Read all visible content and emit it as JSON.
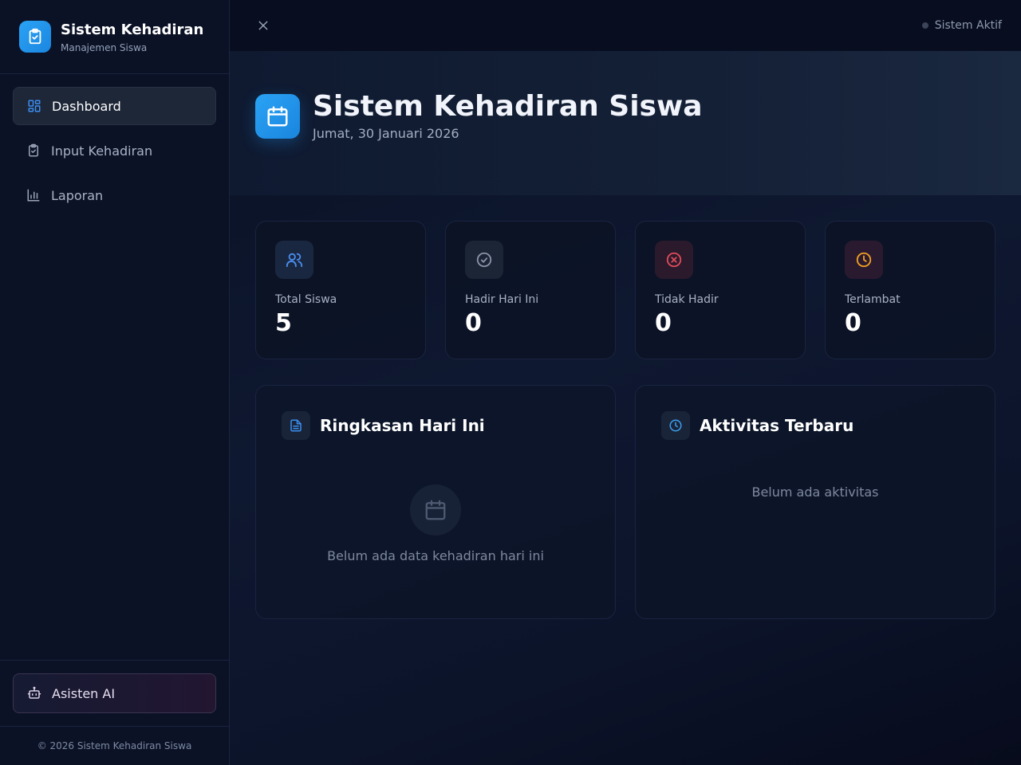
{
  "brand": {
    "title": "Sistem Kehadiran",
    "subtitle": "Manajemen Siswa",
    "logo_icon": "clipboard-check-icon"
  },
  "nav": {
    "items": [
      {
        "label": "Dashboard",
        "icon": "dashboard-grid-icon",
        "active": true
      },
      {
        "label": "Input Kehadiran",
        "icon": "clipboard-check-icon",
        "active": false
      },
      {
        "label": "Laporan",
        "icon": "bar-chart-icon",
        "active": false
      }
    ]
  },
  "sidebar_bottom": {
    "ai_label": "Asisten AI",
    "ai_icon": "robot-icon",
    "copyright": "© 2026 Sistem Kehadiran Siswa"
  },
  "topbar": {
    "status_label": "Sistem Aktif"
  },
  "hero": {
    "title": "Sistem Kehadiran Siswa",
    "date": "Jumat, 30 Januari 2026",
    "icon": "calendar-icon"
  },
  "stats": [
    {
      "label": "Total Siswa",
      "value": "5",
      "icon": "users-icon",
      "color": "#4a8ff0"
    },
    {
      "label": "Hadir Hari Ini",
      "value": "0",
      "icon": "check-circle-icon",
      "color": "#8a94a8"
    },
    {
      "label": "Tidak Hadir",
      "value": "0",
      "icon": "x-circle-icon",
      "color": "#e04b5a"
    },
    {
      "label": "Terlambat",
      "value": "0",
      "icon": "clock-icon",
      "color": "#f0a020"
    }
  ],
  "panels": {
    "summary": {
      "title": "Ringkasan Hari Ini",
      "empty": "Belum ada data kehadiran hari ini",
      "icon": "document-icon"
    },
    "activity": {
      "title": "Aktivitas Terbaru",
      "empty": "Belum ada aktivitas",
      "icon": "clock-icon"
    }
  },
  "colors": {
    "accent": "#2196f3",
    "background": "#0a1022",
    "sidebar": "#0b1226"
  }
}
